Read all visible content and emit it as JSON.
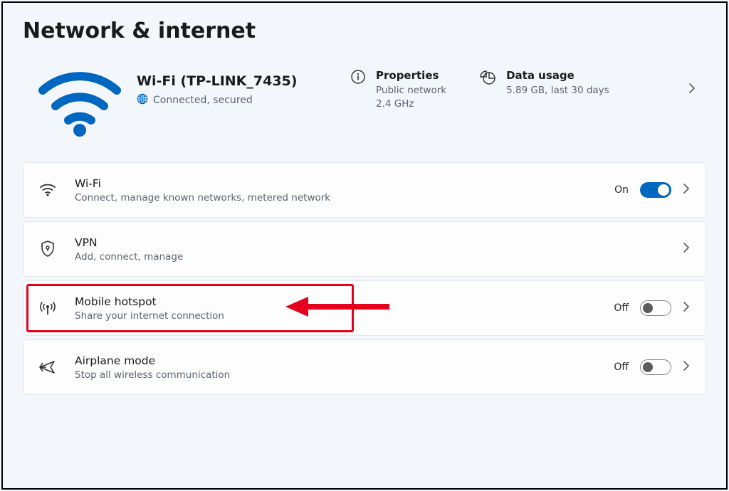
{
  "page": {
    "title": "Network & internet"
  },
  "status": {
    "network_name": "Wi-Fi (TP-LINK_7435)",
    "connection_state": "Connected, secured",
    "properties": {
      "label": "Properties",
      "sub": "Public network\n2.4 GHz"
    },
    "data_usage": {
      "label": "Data usage",
      "sub": "5.89 GB, last 30 days"
    }
  },
  "rows": {
    "wifi": {
      "title": "Wi-Fi",
      "sub": "Connect, manage known networks, metered network",
      "state": "On"
    },
    "vpn": {
      "title": "VPN",
      "sub": "Add, connect, manage"
    },
    "hotspot": {
      "title": "Mobile hotspot",
      "sub": "Share your internet connection",
      "state": "Off"
    },
    "airplane": {
      "title": "Airplane mode",
      "sub": "Stop all wireless communication",
      "state": "Off"
    }
  }
}
